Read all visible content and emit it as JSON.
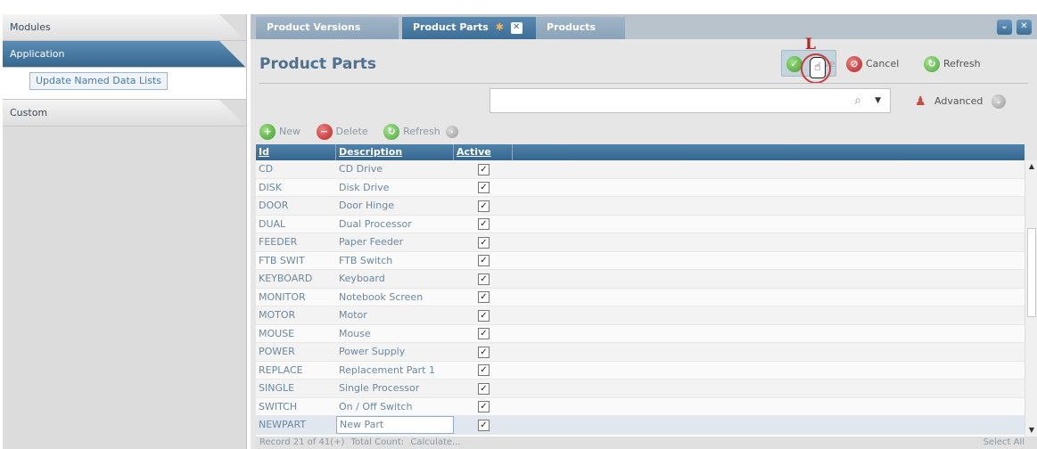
{
  "left_nav": {
    "modules": "Modules",
    "application": "Application",
    "update_named_lists": "Update Named Data Lists",
    "custom": "Custom"
  },
  "tabs": [
    {
      "label": "Product Versions",
      "active": false
    },
    {
      "label": "Product Parts",
      "active": true
    },
    {
      "label": "Products",
      "active": false
    }
  ],
  "window": {
    "collapse_icon": "chevron-double-down-icon",
    "close_icon": "close-icon"
  },
  "toolbar": {
    "title": "Product Parts",
    "save_label": "Save",
    "cancel_label": "Cancel",
    "refresh_label": "Refresh",
    "annotation_letter": "L"
  },
  "search": {
    "value": "",
    "advanced_label": "Advanced"
  },
  "grid_toolbar": {
    "new_label": "New",
    "delete_label": "Delete",
    "refresh_label": "Refresh"
  },
  "grid": {
    "columns": [
      "Id",
      "Description",
      "Active"
    ],
    "rows": [
      {
        "id": "CD",
        "description": "CD Drive",
        "active": true
      },
      {
        "id": "DISK",
        "description": "Disk Drive",
        "active": true
      },
      {
        "id": "DOOR",
        "description": "Door Hinge",
        "active": true
      },
      {
        "id": "DUAL",
        "description": "Dual Processor",
        "active": true
      },
      {
        "id": "FEEDER",
        "description": "Paper Feeder",
        "active": true
      },
      {
        "id": "FTB SWIT",
        "description": "FTB Switch",
        "active": true
      },
      {
        "id": "KEYBOARD",
        "description": "Keyboard",
        "active": true
      },
      {
        "id": "MONITOR",
        "description": "Notebook Screen",
        "active": true
      },
      {
        "id": "MOTOR",
        "description": "Motor",
        "active": true
      },
      {
        "id": "MOUSE",
        "description": "Mouse",
        "active": true
      },
      {
        "id": "POWER",
        "description": "Power Supply",
        "active": true
      },
      {
        "id": "REPLACE",
        "description": "Replacement Part 1",
        "active": true
      },
      {
        "id": "SINGLE",
        "description": "Single Processor",
        "active": true
      },
      {
        "id": "SWITCH",
        "description": "On / Off Switch",
        "active": true
      },
      {
        "id": "NEWPART",
        "description": "New Part",
        "active": true
      }
    ]
  },
  "status": {
    "record": "Record 21 of 41(+)",
    "total_label": "Total Count:",
    "calculate": "Calculate...",
    "select_all": "Select All"
  }
}
